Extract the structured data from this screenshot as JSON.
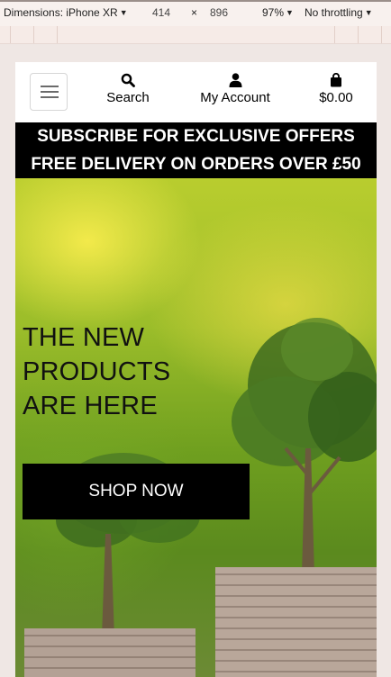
{
  "devtools": {
    "device_label": "Dimensions: iPhone XR",
    "width": "414",
    "times": "×",
    "height": "896",
    "zoom": "97%",
    "throttling": "No throttling"
  },
  "nav": {
    "search_label": "Search",
    "account_label": "My Account",
    "cart_label": "$0.00"
  },
  "promo": {
    "line1": "SUBSCRIBE FOR EXCLUSIVE OFFERS",
    "line2": "FREE DELIVERY ON ORDERS OVER £50"
  },
  "hero": {
    "title_line1": "THE NEW",
    "title_line2": "PRODUCTS",
    "title_line3": "ARE HERE",
    "button_label": "SHOP NOW"
  },
  "colors": {
    "promo_bg": "#000000",
    "button_bg": "#000000",
    "page_bg": "#efe7e4"
  }
}
